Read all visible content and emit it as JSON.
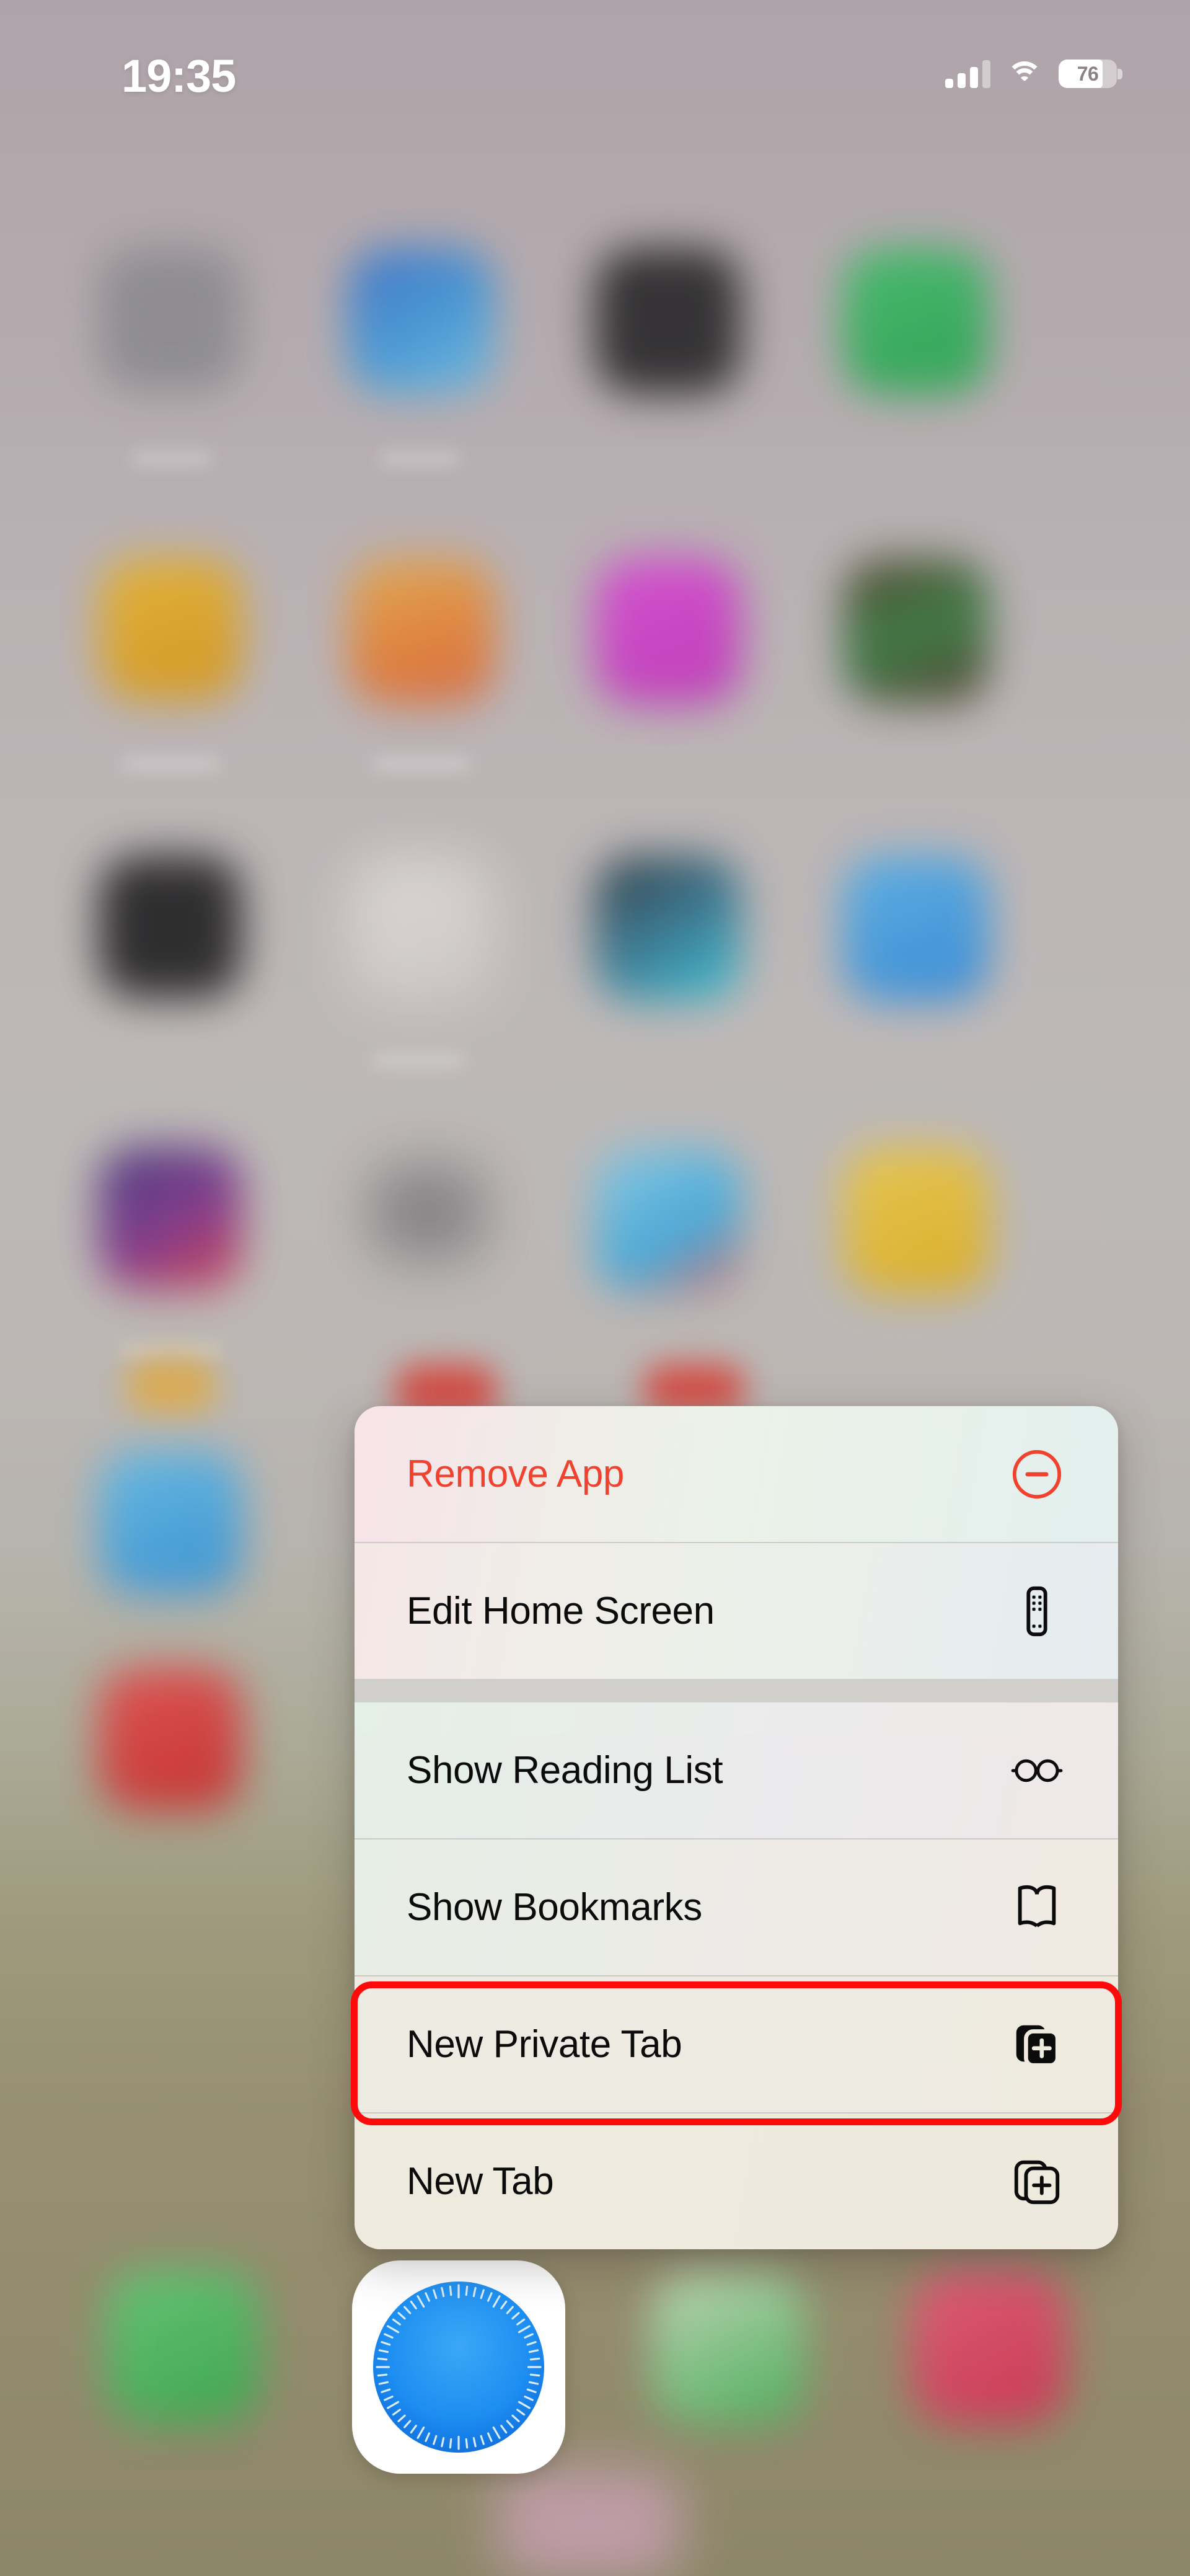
{
  "status_bar": {
    "time": "19:35",
    "battery_percent": "76",
    "battery_level": 76,
    "cellular_bars_filled": 3,
    "cellular_bars_total": 4,
    "wifi_connected": true
  },
  "context_menu": {
    "sections": [
      {
        "items": [
          {
            "label": "Remove App",
            "icon": "minus-circle-icon",
            "destructive": true
          },
          {
            "label": "Edit Home Screen",
            "icon": "home-screen-edit-icon",
            "destructive": false
          }
        ]
      },
      {
        "items": [
          {
            "label": "Show Reading List",
            "icon": "eyeglasses-icon",
            "destructive": false
          },
          {
            "label": "Show Bookmarks",
            "icon": "open-book-icon",
            "destructive": false
          },
          {
            "label": "New Private Tab",
            "icon": "tabs-plus-filled-icon",
            "destructive": false,
            "highlighted": true
          },
          {
            "label": "New Tab",
            "icon": "tabs-plus-outline-icon",
            "destructive": false
          }
        ]
      }
    ]
  },
  "app_icon": {
    "name": "Safari",
    "icon": "safari-compass-icon"
  },
  "colors": {
    "destructive": "#f0422f",
    "highlight_ring": "#ff0a0a",
    "menu_background": "#f2f0ec",
    "status_text": "#ffffff",
    "safari_blue": "#1a8cf0",
    "safari_needle_red": "#f5382a"
  },
  "wallpaper": {
    "blurred": true,
    "app_grid_rows": [
      {
        "colors": [
          "#8e8e92",
          "#2d7fd8",
          "#222224",
          "#34c159"
        ]
      },
      {
        "colors": [
          "#e9a81d",
          "#ef8030",
          "#d63ad0",
          "#4a3620"
        ]
      },
      {
        "colors": [
          "#1b1b1d",
          "#e2dedd",
          "#2b4b5c",
          "#3b9ff0"
        ]
      },
      {
        "colors": [
          "#3a2f7a",
          "#6d6d70",
          "#4ab3e8",
          "#efc221"
        ]
      },
      {
        "colors": [
          "#38a8e8",
          "",
          "",
          ""
        ]
      },
      {
        "colors": [
          "#e23b3b",
          "",
          "",
          ""
        ]
      }
    ],
    "dock_colors": [
      "#46c35a",
      "#ffffff",
      "#43c05c",
      "#e8476a"
    ]
  }
}
